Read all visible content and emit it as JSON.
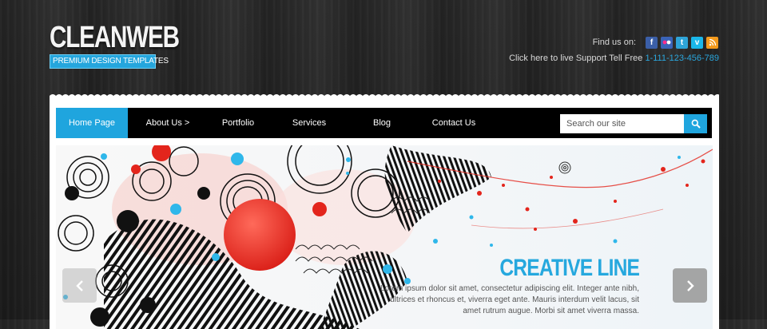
{
  "logo": {
    "name": "CLEANWEB",
    "tagline": "PREMIUM DESIGN TEMPLATES"
  },
  "header": {
    "find_us_label": "Find us on:",
    "social": [
      {
        "name": "facebook-icon",
        "glyph": "f",
        "color": "#3b5fa8"
      },
      {
        "name": "flickr-icon",
        "glyph": "••",
        "color": "#3a63b8"
      },
      {
        "name": "twitter-icon",
        "glyph": "t",
        "color": "#2ea4d8"
      },
      {
        "name": "vimeo-icon",
        "glyph": "v",
        "color": "#1ab7ea"
      },
      {
        "name": "rss-icon",
        "glyph": "⌁",
        "color": "#f39a1d"
      }
    ],
    "support_text": "Click here to live Support  Tell Free ",
    "support_phone": "1-111-123-456-789"
  },
  "nav": {
    "items": [
      {
        "label": "Home Page",
        "active": true
      },
      {
        "label": "About Us >",
        "active": false
      },
      {
        "label": "Portfolio",
        "active": false
      },
      {
        "label": "Services",
        "active": false
      },
      {
        "label": "Blog",
        "active": false
      },
      {
        "label": "Contact Us",
        "active": false
      }
    ],
    "search_placeholder": "Search our site"
  },
  "slider": {
    "title": "CREATIVE LINE",
    "text": "Lorem ipsum dolor sit amet, consectetur adipiscing elit. Integer ante nibh, ultrices et rhoncus et, viverra eget ante. Mauris interdum velit lacus, sit amet rutrum augue. Morbi sit amet viverra massa."
  },
  "colors": {
    "accent": "#1fa5de",
    "nav_bg": "#000000",
    "phone": "#2aa6dc"
  }
}
